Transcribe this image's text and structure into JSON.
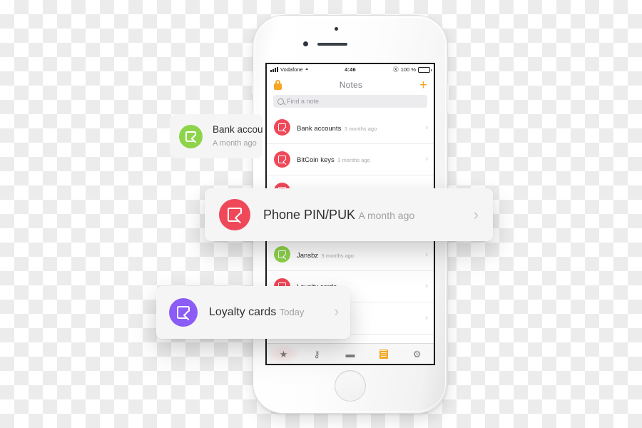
{
  "phone": {
    "status_bar": {
      "carrier": "Vodafone",
      "time": "4:46",
      "battery_percent": "100 %",
      "wifi_icon": "wifi-icon",
      "bluetooth_icon": "bluetooth-icon",
      "signal_icon": "cellular-signal-icon"
    },
    "nav_bar": {
      "title": "Notes",
      "lock_icon": "lock-icon",
      "add_icon": "plus-icon"
    },
    "search": {
      "placeholder": "Find a note",
      "value": "",
      "icon": "search-icon"
    },
    "notes": [
      {
        "title": "Bank accounts",
        "subtitle": "3 months ago",
        "color": "#ef4859",
        "icon": "note-icon"
      },
      {
        "title": "BitCoin keys",
        "subtitle": "3 months ago",
        "color": "#ef4859",
        "icon": "note-icon"
      },
      {
        "title": "",
        "subtitle": "",
        "color": "#ef4859",
        "icon": "note-icon"
      },
      {
        "title": "",
        "subtitle": "",
        "color": "#ef4859",
        "icon": "note-icon"
      },
      {
        "title": "Jansbz",
        "subtitle": "5 months ago",
        "color": "#8ed44a",
        "icon": "note-icon"
      },
      {
        "title": "Loyalty cards",
        "subtitle": "",
        "color": "#ef4859",
        "icon": "note-icon"
      },
      {
        "title": "",
        "subtitle": "",
        "color": "#ef4859",
        "icon": "note-icon"
      }
    ],
    "tab_bar": [
      {
        "icon": "star-icon",
        "glyph": "★",
        "active": false
      },
      {
        "icon": "key-icon",
        "glyph": "⚷",
        "active": false
      },
      {
        "icon": "wallet-card-icon",
        "glyph": "▬",
        "active": false
      },
      {
        "icon": "notes-icon",
        "glyph": "",
        "active": true
      },
      {
        "icon": "gear-icon",
        "glyph": "⚙",
        "active": false
      }
    ]
  },
  "floating_cards": [
    {
      "id": "bank",
      "title": "Bank accounts",
      "subtitle": "A month ago",
      "color": "#8ed44a",
      "icon": "note-icon",
      "chevron": "›"
    },
    {
      "id": "pin",
      "title": "Phone PIN/PUK",
      "subtitle": "A month ago",
      "color": "#ef4859",
      "icon": "note-icon",
      "chevron": "›"
    },
    {
      "id": "loyalty",
      "title": "Loyalty cards",
      "subtitle": "Today",
      "color": "#8b5cf6",
      "icon": "note-icon",
      "chevron": "›"
    }
  ]
}
